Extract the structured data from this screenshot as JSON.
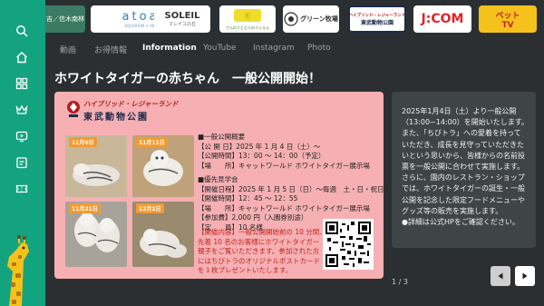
{
  "sidebar": {
    "items": [
      {
        "icon": "search-icon"
      },
      {
        "icon": "home-icon"
      },
      {
        "icon": "grid-icon"
      },
      {
        "icon": "crown-icon"
      },
      {
        "icon": "video-icon"
      },
      {
        "icon": "calendar-icon"
      },
      {
        "icon": "ticket-icon"
      }
    ],
    "mascot": "giraffe"
  },
  "logos": [
    {
      "name": "partial-logo",
      "text": "吉／信木南林"
    },
    {
      "name": "atoa-logo",
      "text": "atoa",
      "sub": "AQUARIUM × ART"
    },
    {
      "name": "soleil-logo",
      "text": "SOLEIL",
      "sub": "マレイユの丘"
    },
    {
      "name": "denen-logo",
      "text": "でんのうとどらのうらえん"
    },
    {
      "name": "green-farm-logo",
      "text": "グリーン牧場"
    },
    {
      "name": "hybrid-leisure-land-logo",
      "text": "ハイブリッド・レジャーランド",
      "sub": "東武動物公園"
    },
    {
      "name": "jcom-logo",
      "text": "J:COM"
    },
    {
      "name": "pet-tv-logo",
      "text": "ペット",
      "sub": "TV"
    }
  ],
  "tabs": [
    {
      "label": "動画"
    },
    {
      "label": "お得情報"
    },
    {
      "label": "Information",
      "active": true
    },
    {
      "label": "YouTube"
    },
    {
      "label": "Instagram"
    },
    {
      "label": "Photo"
    }
  ],
  "post": {
    "title": "ホワイトタイガーの赤ちゃん　一般公開開始！",
    "card": {
      "logo_sub": "ハイブリッド・レジャーランド",
      "logo_main": "東武動物公園",
      "photos": [
        {
          "date": "11月6日"
        },
        {
          "date": "11月11日"
        },
        {
          "date": "11月21日"
        },
        {
          "date": "12月2日"
        }
      ],
      "info_lines": [
        "■一般公開概要",
        "【公 開 日】2025 年 1 月 4 日（土）～",
        "【公開時間】13：00 ～ 14：00（予定）",
        "【場　　所】キャットワールド ホワイトタイガー展示場",
        "",
        "■優先見学会",
        "【開催日程】2025 年 1 月 5 日（日）～毎週　土・日・祝日",
        "【開催時間】12：45 ～ 12：55",
        "【場　　所】キャットワールド ホワイトタイガー展示場",
        "【参加費】2,000 円（入園券別途）",
        "【定　　員】10 名様"
      ],
      "notice_lines": [
        "【開催内容】一般公開開始前の 10 分間、",
        "先着 10 名のお客様にホワイトタイガー",
        "親子をご覧いただきます。参加された方",
        "にはちびトラのオリジナルポストカード",
        "を１枚プレゼントいたします。"
      ]
    },
    "description_lines": [
      "2025年1月4日（土）より一般公開",
      "（13:00~14:00）を開始いたします。",
      "また、「ちびトラ」への愛着を持って",
      "いただき、成長を見守っていただきた",
      "いという思いから、皆様からの名前投",
      "票を一般公開に合わせて実施します。",
      "さらに、園内のレストラン・ショップ",
      "では、ホワイトタイガーの誕生・一般",
      "公開を記念した限定フードメニューや",
      "グッズ等の販売を実施します。",
      "●詳細は公式HPをご確認ください。"
    ]
  },
  "pager": {
    "text": "1 / 3"
  },
  "colors": {
    "sidebar": "#14a37f",
    "background": "#2b2f31",
    "card": "#f6b0b3",
    "panel": "#3f4447",
    "accent_red": "#c0251f"
  }
}
